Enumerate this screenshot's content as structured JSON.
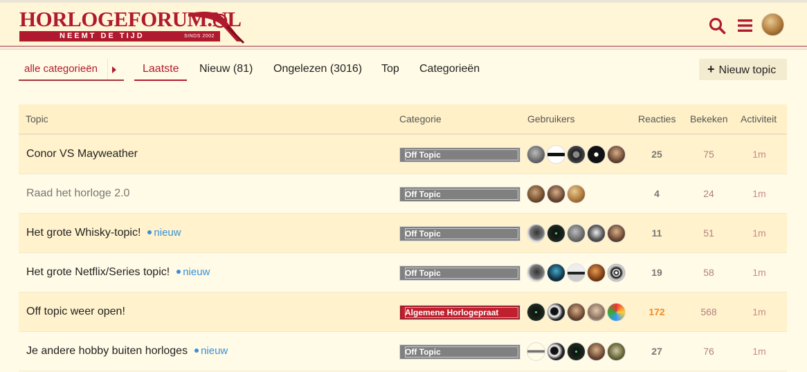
{
  "header": {
    "logo_title": "HORLOGEFORUM.NL",
    "logo_tagline": "NEEMT DE TIJD",
    "logo_since": "SINDS 2002",
    "brand_color": "#b01a2e"
  },
  "nav": {
    "category_select": "alle categorieën",
    "tabs": [
      {
        "label": "Laatste",
        "active": true
      },
      {
        "label": "Nieuw (81)",
        "active": false
      },
      {
        "label": "Ongelezen (3016)",
        "active": false
      },
      {
        "label": "Top",
        "active": false
      },
      {
        "label": "Categorieën",
        "active": false
      }
    ],
    "new_topic_label": "Nieuw topic"
  },
  "table": {
    "columns": {
      "topic": "Topic",
      "category": "Categorie",
      "users": "Gebruikers",
      "replies": "Reacties",
      "views": "Bekeken",
      "activity": "Activiteit"
    },
    "new_label": "nieuw",
    "rows": [
      {
        "title": "Conor VS Mayweather",
        "is_new": false,
        "visited": false,
        "category": "Off Topic",
        "category_color": "#808080",
        "users": 5,
        "replies": "25",
        "views": "75",
        "activity": "1m"
      },
      {
        "title": "Raad het horloge 2.0",
        "is_new": false,
        "visited": true,
        "category": "Off Topic",
        "category_color": "#808080",
        "users": 3,
        "replies": "4",
        "views": "24",
        "activity": "1m"
      },
      {
        "title": "Het grote Whisky-topic!",
        "is_new": true,
        "visited": false,
        "category": "Off Topic",
        "category_color": "#808080",
        "users": 5,
        "replies": "11",
        "views": "51",
        "activity": "1m"
      },
      {
        "title": "Het grote Netflix/Series topic!",
        "is_new": true,
        "visited": false,
        "category": "Off Topic",
        "category_color": "#808080",
        "users": 5,
        "replies": "19",
        "views": "58",
        "activity": "1m"
      },
      {
        "title": "Off topic weer open!",
        "is_new": false,
        "visited": false,
        "category": "Algemene Horlogepraat",
        "category_color": "#c0202e",
        "users": 5,
        "replies": "172",
        "views": "568",
        "activity": "1m"
      },
      {
        "title": "Je andere hobby buiten horloges",
        "is_new": true,
        "visited": false,
        "category": "Off Topic",
        "category_color": "#808080",
        "users": 5,
        "replies": "27",
        "views": "76",
        "activity": "1m"
      }
    ]
  }
}
